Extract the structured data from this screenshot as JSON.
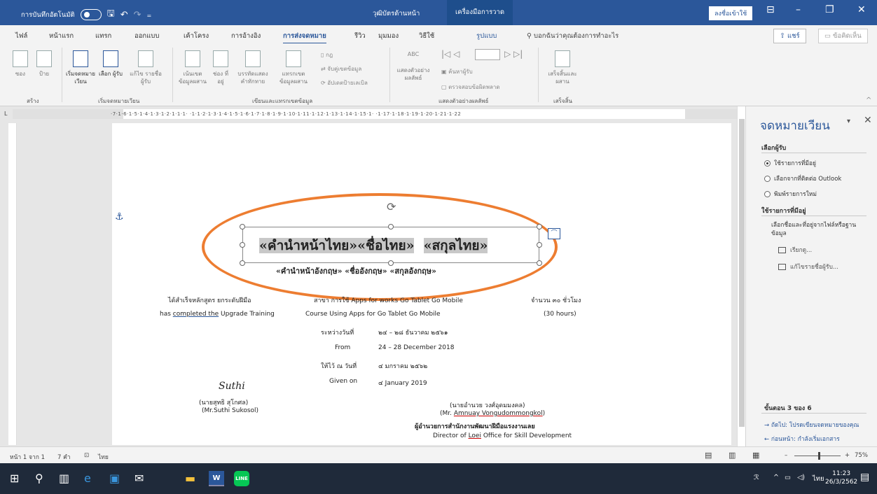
{
  "titlebar": {
    "autosave": "การบันทึกอัตโนมัติ",
    "doc_title": "วุฒิบัตรด้านหน้า",
    "tools_context": "เครื่องมือการวาด",
    "signin": "ลงชื่อเข้าใช้"
  },
  "tabs": [
    "ไฟล์",
    "หน้าแรก",
    "แทรก",
    "ออกแบบ",
    "เค้าโครง",
    "การอ้างอิง",
    "การส่งจดหมาย",
    "รีวิว",
    "มุมมอง",
    "วิธีใช้",
    "รูปแบบ"
  ],
  "active_tab": "การส่งจดหมาย",
  "tell_me": "บอกฉันว่าคุณต้องการทำอะไร",
  "share": "แชร์",
  "comments": "ข้อคิดเห็น",
  "ribbon": {
    "buttons": [
      {
        "label": "ซอง"
      },
      {
        "label": "ป้าย"
      },
      {
        "label": "เริ่มจดหมาย เวียน"
      },
      {
        "label": "เลือก ผู้รับ"
      },
      {
        "label": "แก้ไข รายชื่อผู้รับ"
      },
      {
        "label": "เน้นเขต ข้อมูลผสาน"
      },
      {
        "label": "ช่อง ที่อยู่"
      },
      {
        "label": "บรรทัดแสดง คำทักทาย"
      },
      {
        "label": "แทรกเขต ข้อมูลผสาน"
      },
      {
        "label": "เสร็จสิ้นและ ผสาน"
      }
    ],
    "small": [
      "กฎ",
      "จับคู่เขตข้อมูล",
      "อัปเดตป้ายเลเบิล",
      "ค้นหาผู้รับ",
      "ตรวจสอบข้อผิดพลาด",
      "ABC",
      "แสดงตัวอย่าง ผลลัพธ์"
    ],
    "groups": [
      "สร้าง",
      "เริ่มจดหมายเวียน",
      "เขียนและแทรกเขตข้อมูล",
      "แสดงตัวอย่างผลลัพธ์",
      "เสร็จสิ้น"
    ]
  },
  "ruler_text": "·7·1·6·1·5·1·4·1·3·1·2·1·1·1· ·1·1·2·1·3·1·4·1·5·1·6·1·7·1·8·1·9·1·10·1·11·1·12·1·13·1·14·1·15·1· ·1·17·1·18·1·19·1·20·1·21·1·22",
  "document": {
    "merge_th": [
      "«คำนำหน้าไทย»«ชื่อไทย»",
      "«สกุลไทย»"
    ],
    "merge_en": "«คำนำหน้าอังกฤษ» «ชื่ออังกฤษ»  «สกุลอังกฤษ»",
    "line1_a": "ได้สำเร็จหลักสูตร   ยกระดับฝีมือ",
    "line1_b": "สาขา  การใช้ Apps for works Go Tablet Go Mobile",
    "line1_c": "จำนวน  ๓๐  ชั่วโมง",
    "line2_a_pre": "has ",
    "line2_a_link": "completed  the",
    "line2_a_post": "  Upgrade Training",
    "line2_b": "Course Using Apps for Go Tablet Go Mobile",
    "line2_c": "(30  hours)",
    "between_th": "ระหว่างวันที่",
    "between_th_val": "๒๔ – ๒๘ ธันวาคม ๒๕๖๑",
    "from_en": "From",
    "from_en_val": "24 – 28  December  2018",
    "given_th": "ให้ไว้ ณ วันที่",
    "given_th_val": "๔ มกราคม ๒๕๖๒",
    "given_en": "Given on",
    "given_en_val": "๔  January  2019",
    "signature": "Suthi",
    "sig1_th": "(นายสุทธิ  สุโกศล)",
    "sig1_en": "(Mr.Suthi   Sukosol)",
    "sig2_th": "(นายอำนวย วงศ์อุดมมงคล)",
    "sig2_en_pre": "(Mr. ",
    "sig2_en_name": "Amnuay  Vongudommongkol",
    "sig2_en_post": ")",
    "sig2_title_th": "ผู้อำนวยการสำนักงานพัฒนาฝีมือแรงงานเลย",
    "sig2_title_en_pre": "Director of ",
    "sig2_title_en_loei": "Loei",
    "sig2_title_en_post": " Office for Skill Development"
  },
  "pane": {
    "title": "จดหมายเวียน",
    "select_recipients": "เลือกผู้รับ",
    "options": [
      "ใช้รายการที่มีอยู่",
      "เลือกจากที่ติดต่อ Outlook",
      "พิมพ์รายการใหม่"
    ],
    "selected_option": 0,
    "use_existing": "ใช้รายการที่มีอยู่",
    "description": "เลือกชื่อและที่อยู่จากไฟล์หรือฐานข้อมูล",
    "browse": "เรียกดู...",
    "edit_list": "แก้ไขรายชื่อผู้รับ...",
    "step": "ขั้นตอน 3 ของ 6",
    "next": "ถัดไป: โปรดเขียนจดหมายของคุณ",
    "prev": "ก่อนหน้า: กำลังเริ่มเอกสาร"
  },
  "status": {
    "page": "หน้า 1 จาก 1",
    "words": "7 คำ",
    "lang": "ไทย",
    "zoom": "75%"
  },
  "taskbar": {
    "word": "W",
    "line": "LINE",
    "lang": "ไทย",
    "time": "11:23",
    "date": "26/3/2562"
  },
  "colors": {
    "accent": "#2b579a",
    "ellipse": "#ed7d31",
    "mergefield": "#c8c8c8"
  }
}
